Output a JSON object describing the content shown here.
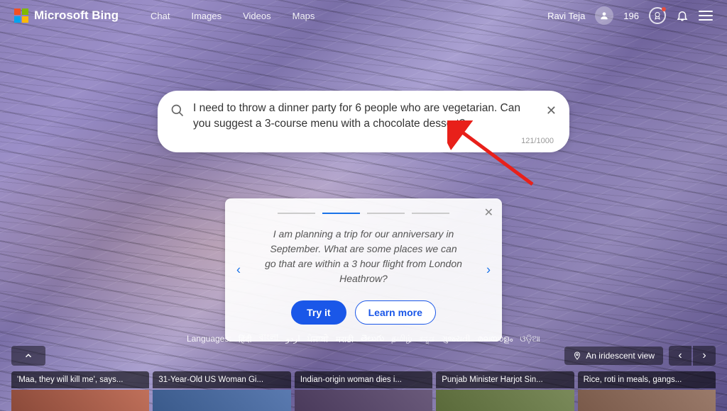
{
  "header": {
    "brand": "Microsoft Bing",
    "nav": {
      "chat": "Chat",
      "images": "Images",
      "videos": "Videos",
      "maps": "Maps"
    },
    "user_name": "Ravi Teja",
    "points": "196"
  },
  "search": {
    "query": "I need to throw a dinner party for 6 people who are vegetarian. Can you suggest a 3-course menu with a chocolate dessert?",
    "char_count": "121/1000"
  },
  "promo": {
    "text": "I am planning a trip for our anniversary in September. What are some places we can go that are within a 3 hour flight from London Heathrow?",
    "try_label": "Try it",
    "learn_label": "Learn more"
  },
  "languages": {
    "label": "Languages:",
    "items": [
      "हिंदी",
      "বাংলা",
      "اردو",
      "ਪੰਜਾਬੀ",
      "मराठी",
      "తెలుగు",
      "தமிழ்",
      "ಕನ್ನಡ",
      "ગુજરાતી",
      "മലയാളം",
      "ଓଡ଼ିଆ"
    ]
  },
  "location": {
    "caption": "An iridescent view"
  },
  "news": [
    {
      "title": "'Maa, they will kill me', says..."
    },
    {
      "title": "31-Year-Old US Woman Gi..."
    },
    {
      "title": "Indian-origin woman dies i..."
    },
    {
      "title": "Punjab Minister Harjot Sin..."
    },
    {
      "title": "Rice, roti in meals, gangs..."
    }
  ]
}
